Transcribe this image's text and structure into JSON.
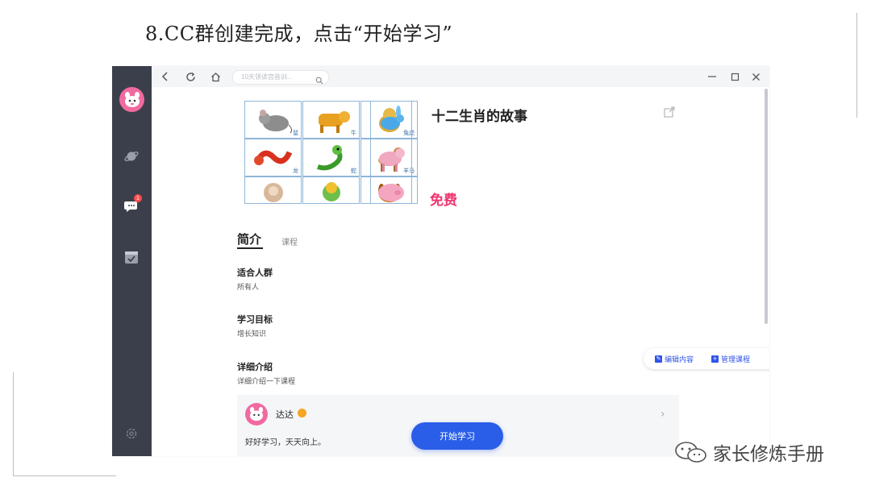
{
  "caption": "8.CC群创建完成，点击“开始学习”",
  "search": {
    "placeholder": "10天领读宫音训..."
  },
  "sidebar": {
    "badge_count": "1"
  },
  "course": {
    "title": "十二生肖的故事",
    "price": "免费",
    "zodiac_labels": [
      "鼠",
      "牛",
      "虎",
      "兔",
      "龙",
      "蛇",
      "马",
      "羊"
    ]
  },
  "tabs": {
    "active": "简介",
    "other": "课程"
  },
  "sections": [
    {
      "label": "适合人群",
      "text": "所有人"
    },
    {
      "label": "学习目标",
      "text": "增长知识"
    },
    {
      "label": "详细介绍",
      "text": "详细介绍一下课程"
    }
  ],
  "actions": {
    "edit": "编辑内容",
    "manage": "管理课程"
  },
  "comment": {
    "name": "达达",
    "text": "好好学习，天天向上。"
  },
  "start_button": "开始学习",
  "watermark": "家长修炼手册",
  "colors": {
    "sidebar": "#3b3f4b",
    "accent": "#2a5ee8",
    "price": "#f0346e"
  }
}
